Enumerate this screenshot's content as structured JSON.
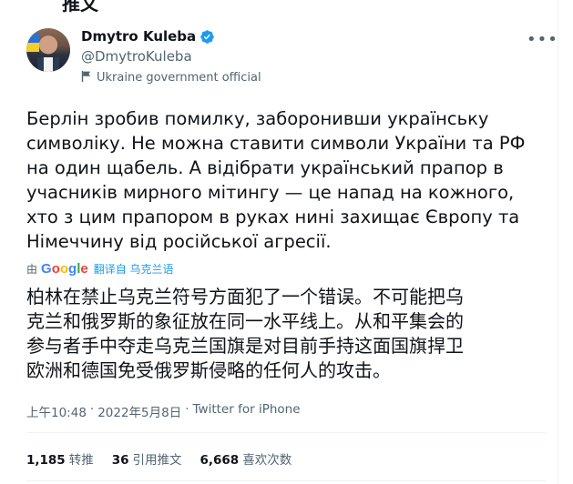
{
  "header": {
    "partial_title": "推文"
  },
  "author": {
    "name": "Dmytro Kuleba",
    "handle": "@DmytroKuleba",
    "affiliation": "Ukraine government official"
  },
  "tweet": {
    "text": "Берлін зробив помилку, заборонивши українську\nсимволіку. Не можна ставити символи України та РФ\nна один щабель. А відібрати український прапор в\nучасників мирного мітингу — це напад на кожного,\nхто з цим прапором в руках нині захищає Європу та\nНімеччину від російської агресії.",
    "translate_by": "由",
    "translate_link": "翻译自 乌克兰语",
    "translated_text": "柏林在禁止乌克兰符号方面犯了一个错误。不可能把乌\n克兰和俄罗斯的象征放在同一水平线上。从和平集会的\n参与者手中夺走乌克兰国旗是对目前手持这面国旗捍卫\n欧洲和德国免受俄罗斯侵略的任何人的攻击。",
    "time": "上午10:48",
    "date": "2022年5月8日",
    "source": "Twitter for iPhone"
  },
  "stats": [
    {
      "num": "1,185",
      "label": "转推"
    },
    {
      "num": "36",
      "label": "引用推文"
    },
    {
      "num": "6,668",
      "label": "喜欢次数"
    }
  ],
  "colors": {
    "verified": "#1d9bf0",
    "link": "#1d9bf0",
    "secondary": "#536471"
  }
}
